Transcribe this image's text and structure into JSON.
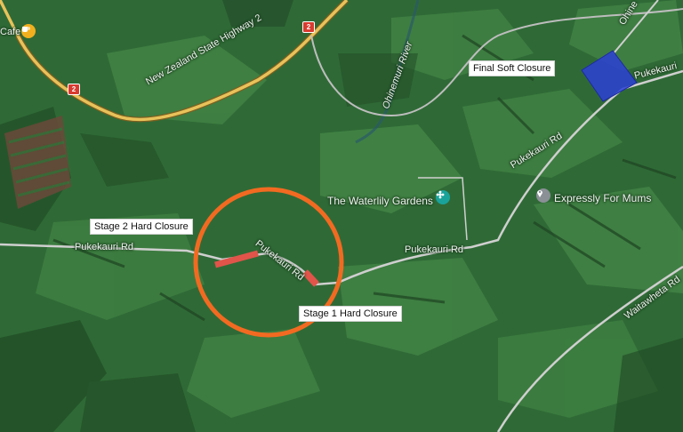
{
  "colors": {
    "terrain_base": "#2f6a36",
    "pasture_light": "#4c8f4c",
    "highway": "#e8c25a",
    "local_road": "#c7c7c7",
    "closure_ring": "#f26a21",
    "hard_closure": "#e0544a",
    "soft_closure": "#2c3fd6",
    "poi_gold": "#f2b01e",
    "poi_teal": "#1aa39b",
    "poi_grey": "#8a9096"
  },
  "labels": {
    "highway": "New Zealand State Highway 2",
    "river": "Ohinemuri River",
    "road_west": "Pukekauri Rd",
    "road_circle": "Pukekauri Rd",
    "road_mid": "Pukekauri Rd",
    "road_ne": "Pukekauri Rd",
    "road_ne_edge": "Pukekauri",
    "road_top_right": "Ohine",
    "road_se": "Waitawheta Rd",
    "highway_shield_1": "2",
    "highway_shield_2": "2",
    "cafe": "Cafe"
  },
  "pois": {
    "waterlily": "The Waterlily Gardens",
    "expressly": "Expressly For Mums"
  },
  "callouts": {
    "stage2": "Stage 2 Hard Closure",
    "stage1": "Stage 1 Hard Closure",
    "final_soft": "Final Soft Closure"
  },
  "icons": {
    "cafe": "coffee-cup-icon",
    "waterlily": "garden-flower-icon",
    "expressly": "location-pin-icon"
  }
}
